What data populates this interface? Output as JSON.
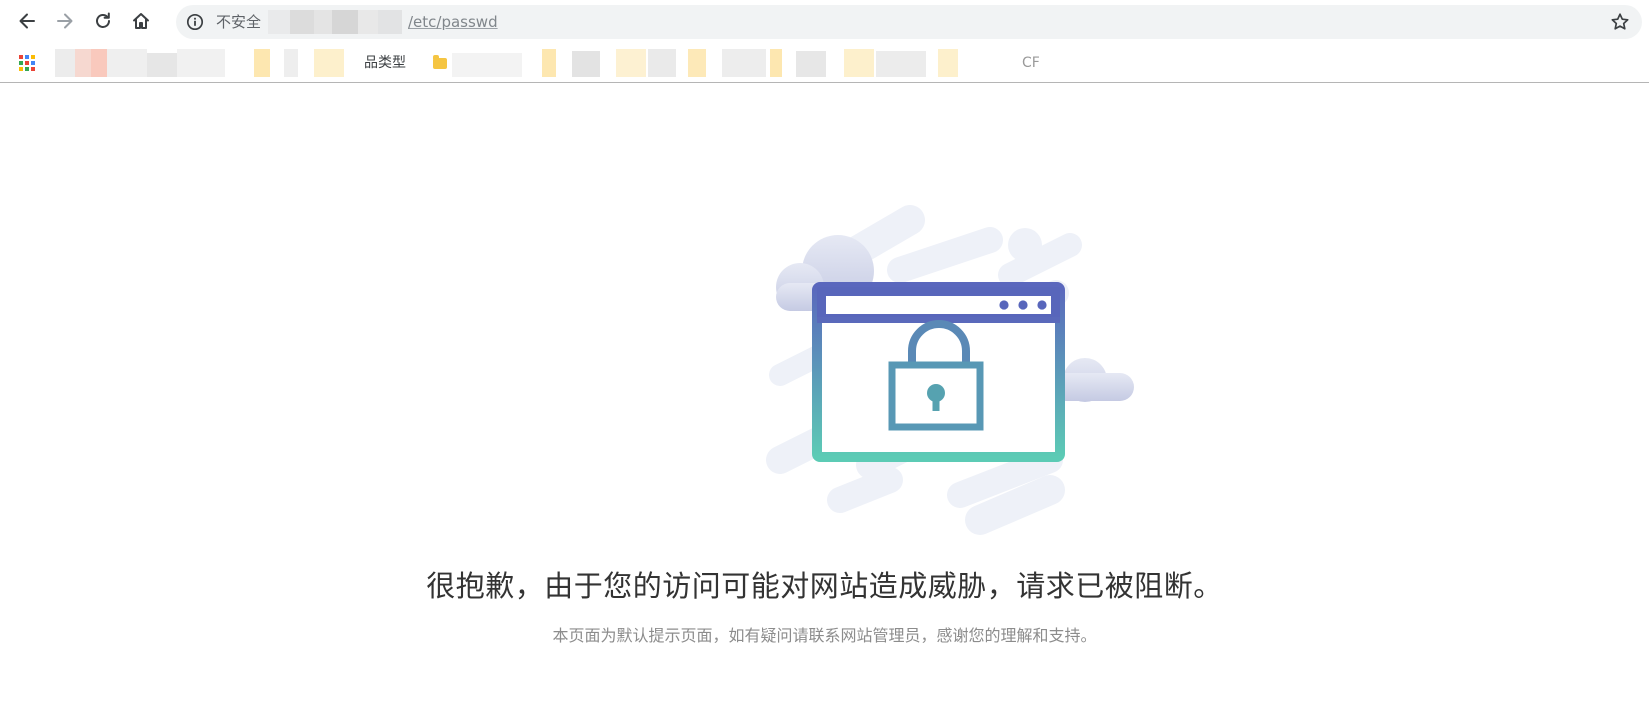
{
  "browser": {
    "security_label": "不安全",
    "url": "/etc/passwd",
    "bookmark_labels": [
      "品类型",
      "CF"
    ]
  },
  "icons": {
    "back": "arrow-left-icon",
    "forward": "arrow-right-icon",
    "reload": "reload-icon",
    "home": "home-icon",
    "info": "info-icon",
    "bookmark_star": "star-icon",
    "apps": "apps-grid-icon",
    "folder": "folder-icon",
    "illustration": "locked-browser-window-icon"
  },
  "colors": {
    "illustration_top": "#5a67bd",
    "illustration_bottom": "#5ccbb5",
    "title_text": "#333333",
    "subtitle_text": "#8c8c8c"
  },
  "page": {
    "title": "很抱歉，由于您的访问可能对网站造成威胁，请求已被阻断。",
    "subtitle": "本页面为默认提示页面，如有疑问请联系网站管理员，感谢您的理解和支持。"
  }
}
